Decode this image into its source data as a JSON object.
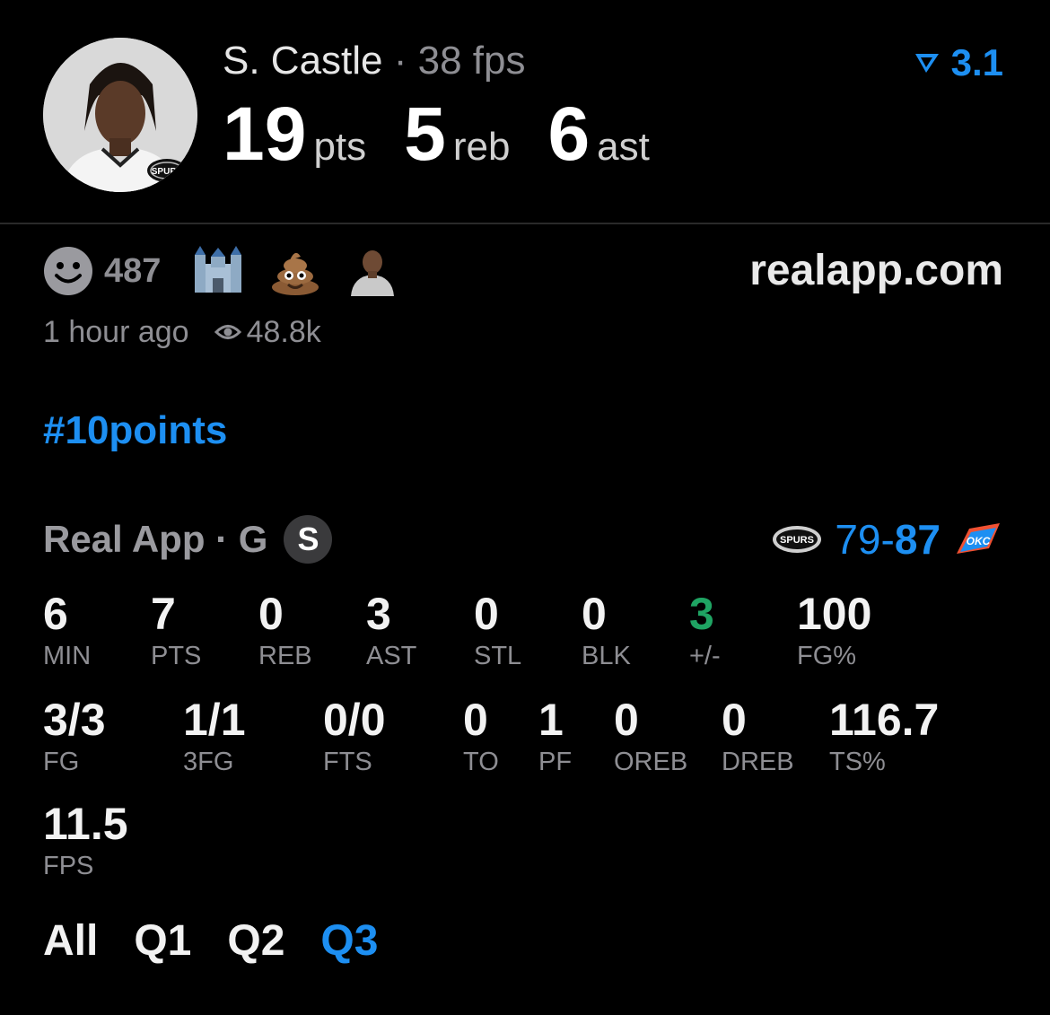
{
  "player": {
    "name": "S. Castle",
    "separator": "·",
    "fps": "38 fps",
    "rating": "3.1",
    "pts": "19",
    "pts_unit": "pts",
    "reb": "5",
    "reb_unit": "reb",
    "ast": "6",
    "ast_unit": "ast",
    "jersey_text": "SPURS"
  },
  "post": {
    "reaction_count": "487",
    "reactions": [
      "castle-emoji",
      "poop-emoji",
      "person-avatar"
    ],
    "site": "realapp.com",
    "time_ago": "1 hour ago",
    "views": "48.8k",
    "hashtag": "#10points"
  },
  "game": {
    "source": "Real App · G",
    "badge": "S",
    "score_home": "79",
    "score_dash": "-",
    "score_away": "87",
    "home_logo_text": "SPURS",
    "away_logo_text": "OKC"
  },
  "stats": [
    {
      "value": "6",
      "label": "MIN"
    },
    {
      "value": "7",
      "label": "PTS"
    },
    {
      "value": "0",
      "label": "REB"
    },
    {
      "value": "3",
      "label": "AST"
    },
    {
      "value": "0",
      "label": "STL"
    },
    {
      "value": "0",
      "label": "BLK"
    },
    {
      "value": "3",
      "label": "+/-"
    },
    {
      "value": "100",
      "label": "FG%"
    },
    {
      "value": "3/3",
      "label": "FG"
    },
    {
      "value": "1/1",
      "label": "3FG"
    },
    {
      "value": "0/0",
      "label": "FTS"
    },
    {
      "value": "0",
      "label": "TO"
    },
    {
      "value": "1",
      "label": "PF"
    },
    {
      "value": "0",
      "label": "OREB"
    },
    {
      "value": "0",
      "label": "DREB"
    },
    {
      "value": "116.7",
      "label": "TS%"
    },
    {
      "value": "11.5",
      "label": "FPS"
    }
  ],
  "tabs": [
    {
      "label": "All"
    },
    {
      "label": "Q1"
    },
    {
      "label": "Q2"
    },
    {
      "label": "Q3",
      "active": true
    }
  ],
  "colors": {
    "accent": "#1d8ff2",
    "positive": "#1fa463",
    "muted": "#8e8e93",
    "background": "#000000"
  }
}
